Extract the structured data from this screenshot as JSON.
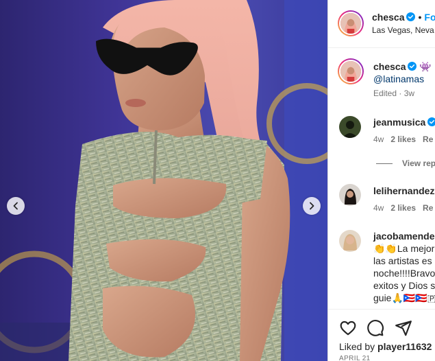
{
  "post": {
    "username": "chesca",
    "follow_label": "Fo",
    "location": "Las Vegas, Neva"
  },
  "caption": {
    "username": "chesca",
    "emoji": "👾",
    "mention": "@latinamas",
    "edited": "Edited",
    "age": "3w"
  },
  "comments": [
    {
      "username": "jeanmusica",
      "age": "4w",
      "likes": "2 likes",
      "reply": "Re",
      "view_replies": "View rep"
    },
    {
      "username": "lelihernandez",
      "age": "4w",
      "likes": "2 likes",
      "reply": "Re"
    },
    {
      "username": "jacobamende",
      "lines": [
        "👏👏La mejor",
        "las artistas es",
        "noche!!!!Bravo",
        "exitos y Dios s",
        "guie🙏🇵🇷🇵🇷🇵"
      ]
    }
  ],
  "actions": {
    "icons": [
      "heart-icon",
      "comment-icon",
      "share-icon"
    ],
    "liked_by_prefix": "Liked by",
    "liked_by_user": "player11632",
    "date": "APRIL 21"
  },
  "colors": {
    "accent": "#0095f6",
    "verified": "#0095f6",
    "text": "#262626",
    "muted": "#737373"
  }
}
